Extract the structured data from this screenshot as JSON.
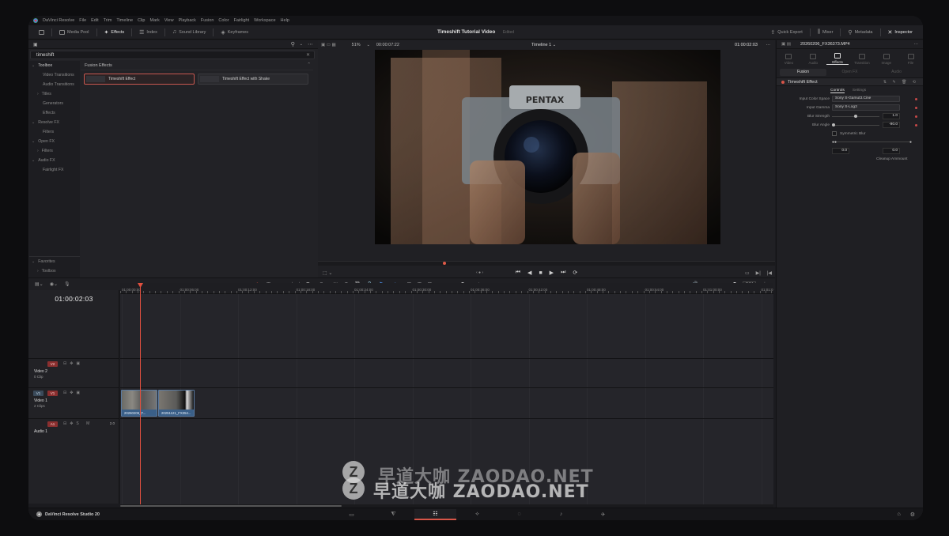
{
  "menubar": {
    "app_name": "DaVinci Resolve",
    "items": [
      "File",
      "Edit",
      "Trim",
      "Timeline",
      "Clip",
      "Mark",
      "View",
      "Playback",
      "Fusion",
      "Color",
      "Fairlight",
      "Workspace",
      "Help"
    ]
  },
  "toolbar": {
    "media_pool": "Media Pool",
    "effects": "Effects",
    "index": "Index",
    "sound_library": "Sound Library",
    "keyframes": "Keyframes",
    "project_title": "Timeshift Tutorial Video",
    "status": "Edited",
    "quick_export": "Quick Export",
    "mixer": "Mixer",
    "metadata": "Metadata",
    "inspector": "Inspector"
  },
  "effects_panel": {
    "search_value": "timeshift",
    "toolbox": {
      "header": "Toolbox",
      "items": [
        {
          "label": "Video Transitions",
          "level": "sub"
        },
        {
          "label": "Audio Transitions",
          "level": "sub"
        },
        {
          "label": "Titles",
          "level": "group"
        },
        {
          "label": "Generators",
          "level": "sub"
        },
        {
          "label": "Effects",
          "level": "sub"
        },
        {
          "label": "Resolve FX",
          "level": "header"
        },
        {
          "label": "Filters",
          "level": "sub"
        },
        {
          "label": "Open FX",
          "level": "header"
        },
        {
          "label": "Filters",
          "level": "sub"
        },
        {
          "label": "Audio FX",
          "level": "header"
        },
        {
          "label": "Fairlight FX",
          "level": "sub"
        }
      ],
      "favorites": "Favorites",
      "favorites_toolbox": "Toolbox"
    },
    "category": "Fusion Effects",
    "results": [
      "Timeshift Effect",
      "Timeshift Effect with Shake"
    ]
  },
  "viewer": {
    "zoom": "51%",
    "timecode_left": "00:00:07:22",
    "timeline_name": "Timeline 1",
    "timecode_right": "01:00:02:03",
    "camera_brand": "PENTAX"
  },
  "inspector": {
    "clip_name": "20260206_FX36373.MP4",
    "tabs": [
      "Video",
      "Audio",
      "Effects",
      "Transition",
      "Image",
      "File"
    ],
    "active_tab": "Effects",
    "sub_tabs": [
      "Fusion",
      "Open FX",
      "Audio"
    ],
    "active_sub": "Fusion",
    "effect_name": "Timeshift Effect",
    "control_tabs": [
      "Controls",
      "Settings"
    ],
    "props": {
      "input_color_space_label": "Input Color Space",
      "input_color_space": "Sony S-Gamut3.Cine",
      "input_gamma_label": "Input Gamma",
      "input_gamma": "Sony S-Log3",
      "blur_strength_label": "Blur Strength",
      "blur_strength": "1.0",
      "blur_angle_label": "Blur Angle",
      "blur_angle": "-90.0",
      "symmetric_blur": "Symmetric Blur",
      "value_a": "0.0",
      "value_b": "0.0",
      "cleanup_label": "Cleanup Ammount"
    }
  },
  "timeline": {
    "timecode": "01:00:02:03",
    "ruler": [
      "01:00:00:00",
      "01:00:06:00",
      "01:00:12:00",
      "01:00:18:00",
      "01:00:24:00",
      "01:00:30:00",
      "01:00:36:00",
      "01:00:42:00",
      "01:00:48:00",
      "01:00:54:00",
      "01:01:00:00",
      "01:01:0"
    ],
    "dim": "DIM",
    "tracks": {
      "v2": {
        "badge": "V2",
        "name": "Video 2",
        "count": "0 Clip"
      },
      "v1": {
        "badge": "V1",
        "badge_src": "V1",
        "name": "Video 1",
        "count": "2 Clips"
      },
      "a1": {
        "badge": "A1",
        "name": "Audio 1",
        "volume": "2.0"
      }
    },
    "clips": [
      "20260206_F...",
      "20251121_FX354..."
    ]
  },
  "bottom": {
    "brand": "DaVinci Resolve Studio 20"
  },
  "watermark": {
    "text": "早道大咖 ZAODAO.NET",
    "logo": "Z"
  },
  "colors": {
    "accent_red": "#d85548",
    "clip_blue": "#3a5f88",
    "playhead": "#e0503f"
  }
}
